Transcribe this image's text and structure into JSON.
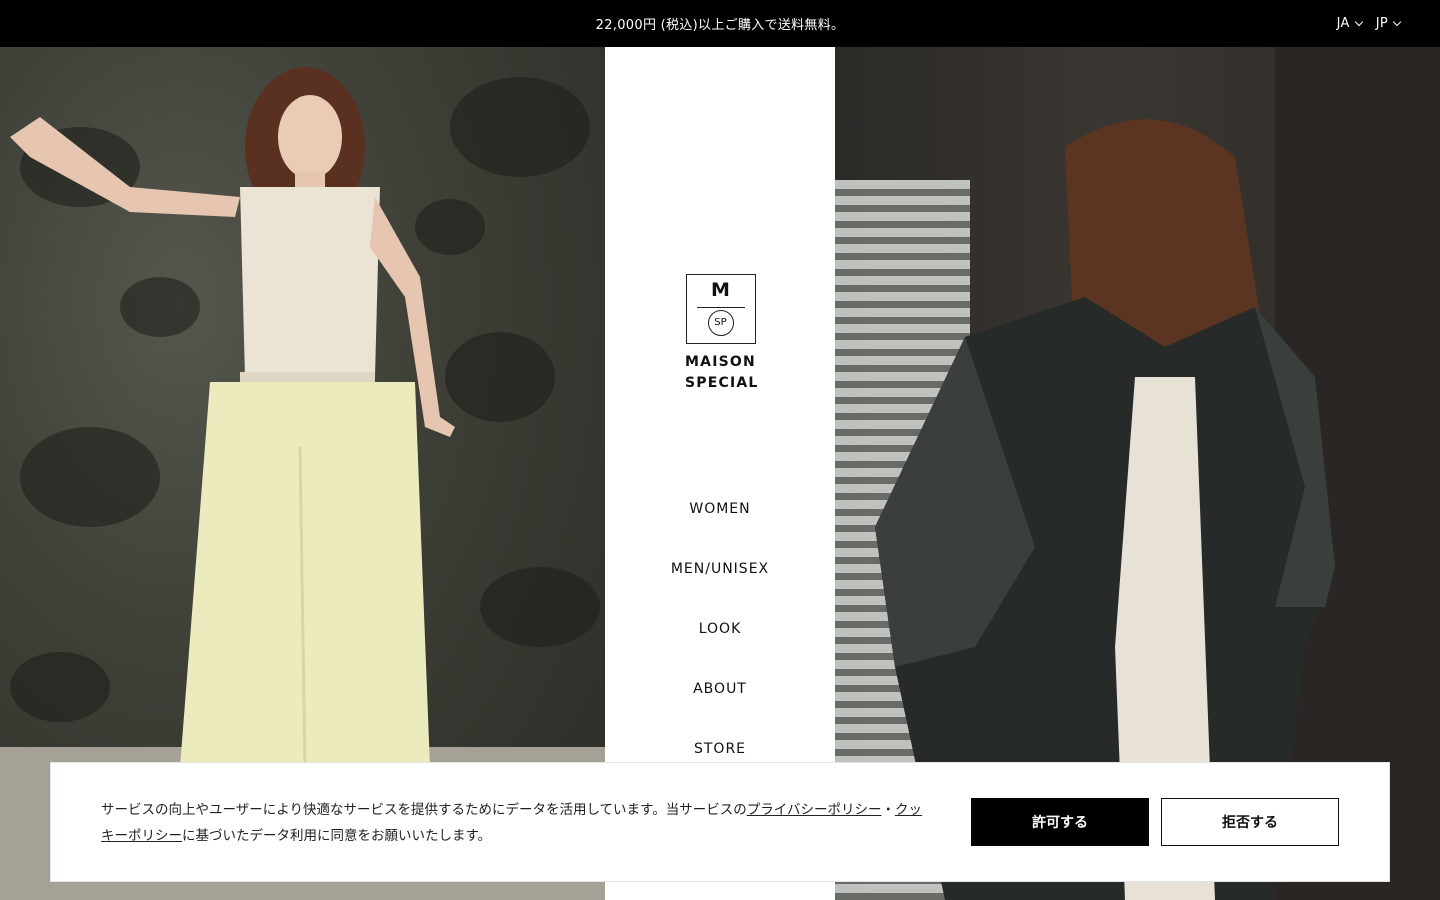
{
  "announcement": "22,000円 (税込)以上ご購入で送料無料。",
  "locale": {
    "language": "JA",
    "region": "JP"
  },
  "logo": {
    "mark_letter": "M",
    "mark_circle": "SP",
    "line1": "MAISON",
    "line2": "SPECIAL"
  },
  "nav": [
    "WOMEN",
    "MEN/UNISEX",
    "LOOK",
    "ABOUT",
    "STORE"
  ],
  "cookie": {
    "text_before": "サービスの向上やユーザーにより快適なサービスを提供するためにデータを活用しています。当サービスの",
    "privacy_link": "プライバシーポリシー",
    "separator": "・",
    "cookie_link": "クッキーポリシー",
    "text_after": "に基づいたデータ利用に同意をお願いいたします。",
    "accept_label": "許可する",
    "reject_label": "拒否する"
  },
  "colors": {
    "topbar_bg": "#000000",
    "accept_bg": "#000000"
  }
}
